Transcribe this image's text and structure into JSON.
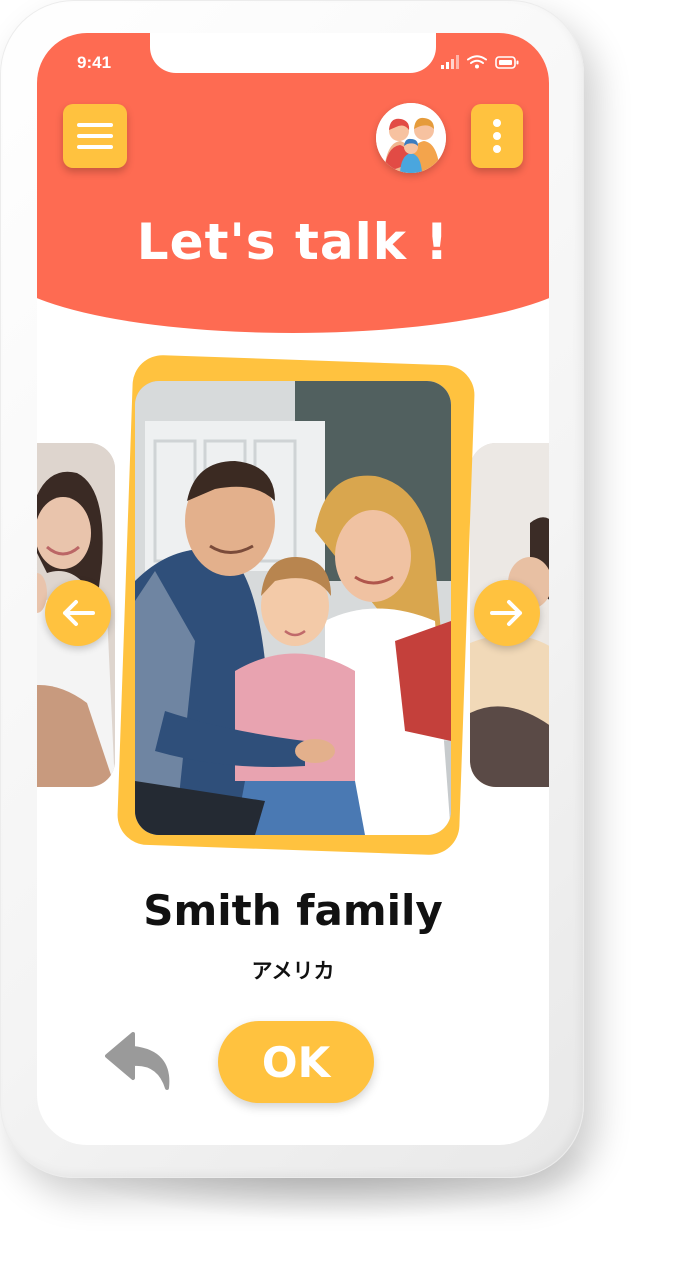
{
  "status_bar": {
    "time": "9:41"
  },
  "header": {
    "title": "Let's talk !",
    "menu_icon": "hamburger-menu-icon",
    "more_icon": "vertical-dots-icon",
    "avatar_icon": "family-avatar-icon"
  },
  "carousel": {
    "current": {
      "name": "Smith family",
      "country": "アメリカ"
    },
    "prev_icon": "arrow-left-icon",
    "next_icon": "arrow-right-icon"
  },
  "actions": {
    "ok_label": "OK",
    "back_icon": "undo-arrow-icon"
  },
  "colors": {
    "header": "#fe6b52",
    "accent": "#ffc23f",
    "text": "#111111"
  }
}
